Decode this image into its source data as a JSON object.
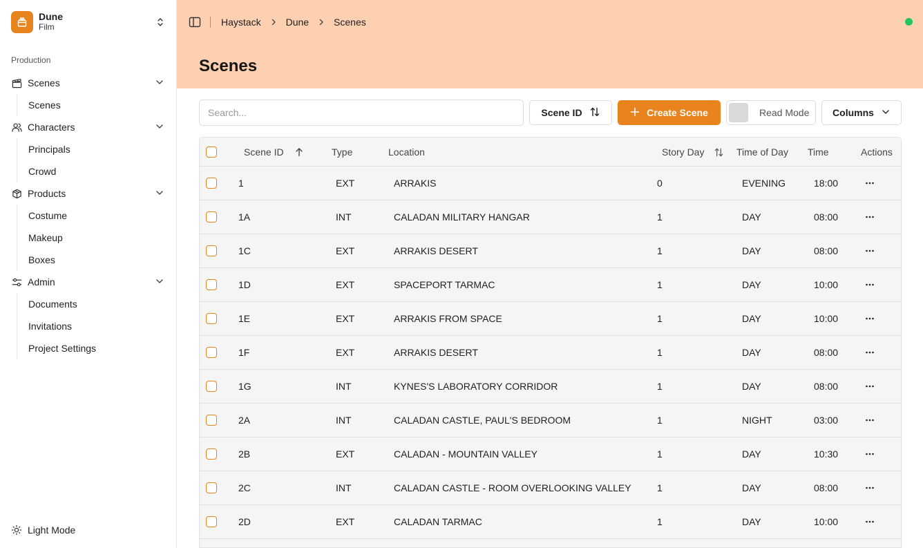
{
  "project": {
    "name": "Dune",
    "type": "Film"
  },
  "sidebar": {
    "group_label": "Production",
    "sections": [
      {
        "label": "Scenes",
        "icon": "clapperboard-icon",
        "items": [
          "Scenes"
        ]
      },
      {
        "label": "Characters",
        "icon": "users-icon",
        "items": [
          "Principals",
          "Crowd"
        ]
      },
      {
        "label": "Products",
        "icon": "package-icon",
        "items": [
          "Costume",
          "Makeup",
          "Boxes"
        ]
      },
      {
        "label": "Admin",
        "icon": "sliders-icon",
        "items": [
          "Documents",
          "Invitations",
          "Project Settings"
        ]
      }
    ],
    "theme_toggle": "Light Mode"
  },
  "breadcrumb": [
    "Haystack",
    "Dune",
    "Scenes"
  ],
  "status": {
    "color": "#22c55e"
  },
  "page_title": "Scenes",
  "toolbar": {
    "search_placeholder": "Search...",
    "sort_label": "Scene ID",
    "create_label": "Create Scene",
    "read_mode_label": "Read Mode",
    "columns_label": "Columns"
  },
  "table": {
    "headers": {
      "scene_id": "Scene ID",
      "type": "Type",
      "location": "Location",
      "story_day": "Story Day",
      "time_of_day": "Time of Day",
      "time": "Time",
      "actions": "Actions"
    },
    "rows": [
      {
        "scene_id": "1",
        "type": "EXT",
        "location": "ARRAKIS",
        "story_day": "0",
        "time_of_day": "EVENING",
        "time": "18:00"
      },
      {
        "scene_id": "1A",
        "type": "INT",
        "location": "CALADAN MILITARY HANGAR",
        "story_day": "1",
        "time_of_day": "DAY",
        "time": "08:00"
      },
      {
        "scene_id": "1C",
        "type": "EXT",
        "location": "ARRAKIS DESERT",
        "story_day": "1",
        "time_of_day": "DAY",
        "time": "08:00"
      },
      {
        "scene_id": "1D",
        "type": "EXT",
        "location": "SPACEPORT TARMAC",
        "story_day": "1",
        "time_of_day": "DAY",
        "time": "10:00"
      },
      {
        "scene_id": "1E",
        "type": "EXT",
        "location": "ARRAKIS FROM SPACE",
        "story_day": "1",
        "time_of_day": "DAY",
        "time": "10:00"
      },
      {
        "scene_id": "1F",
        "type": "EXT",
        "location": "ARRAKIS DESERT",
        "story_day": "1",
        "time_of_day": "DAY",
        "time": "08:00"
      },
      {
        "scene_id": "1G",
        "type": "INT",
        "location": "KYNES'S LABORATORY CORRIDOR",
        "story_day": "1",
        "time_of_day": "DAY",
        "time": "08:00"
      },
      {
        "scene_id": "2A",
        "type": "INT",
        "location": "CALADAN CASTLE, PAUL'S BEDROOM",
        "story_day": "1",
        "time_of_day": "NIGHT",
        "time": "03:00"
      },
      {
        "scene_id": "2B",
        "type": "EXT",
        "location": "CALADAN - MOUNTAIN VALLEY",
        "story_day": "1",
        "time_of_day": "DAY",
        "time": "10:30"
      },
      {
        "scene_id": "2C",
        "type": "INT",
        "location": "CALADAN CASTLE - ROOM OVERLOOKING VALLEY",
        "story_day": "1",
        "time_of_day": "DAY",
        "time": "08:00"
      },
      {
        "scene_id": "2D",
        "type": "EXT",
        "location": "CALADAN TARMAC",
        "story_day": "1",
        "time_of_day": "DAY",
        "time": "10:00"
      }
    ]
  },
  "colors": {
    "accent": "#e8831e",
    "header_bg": "#fdd0b1"
  }
}
